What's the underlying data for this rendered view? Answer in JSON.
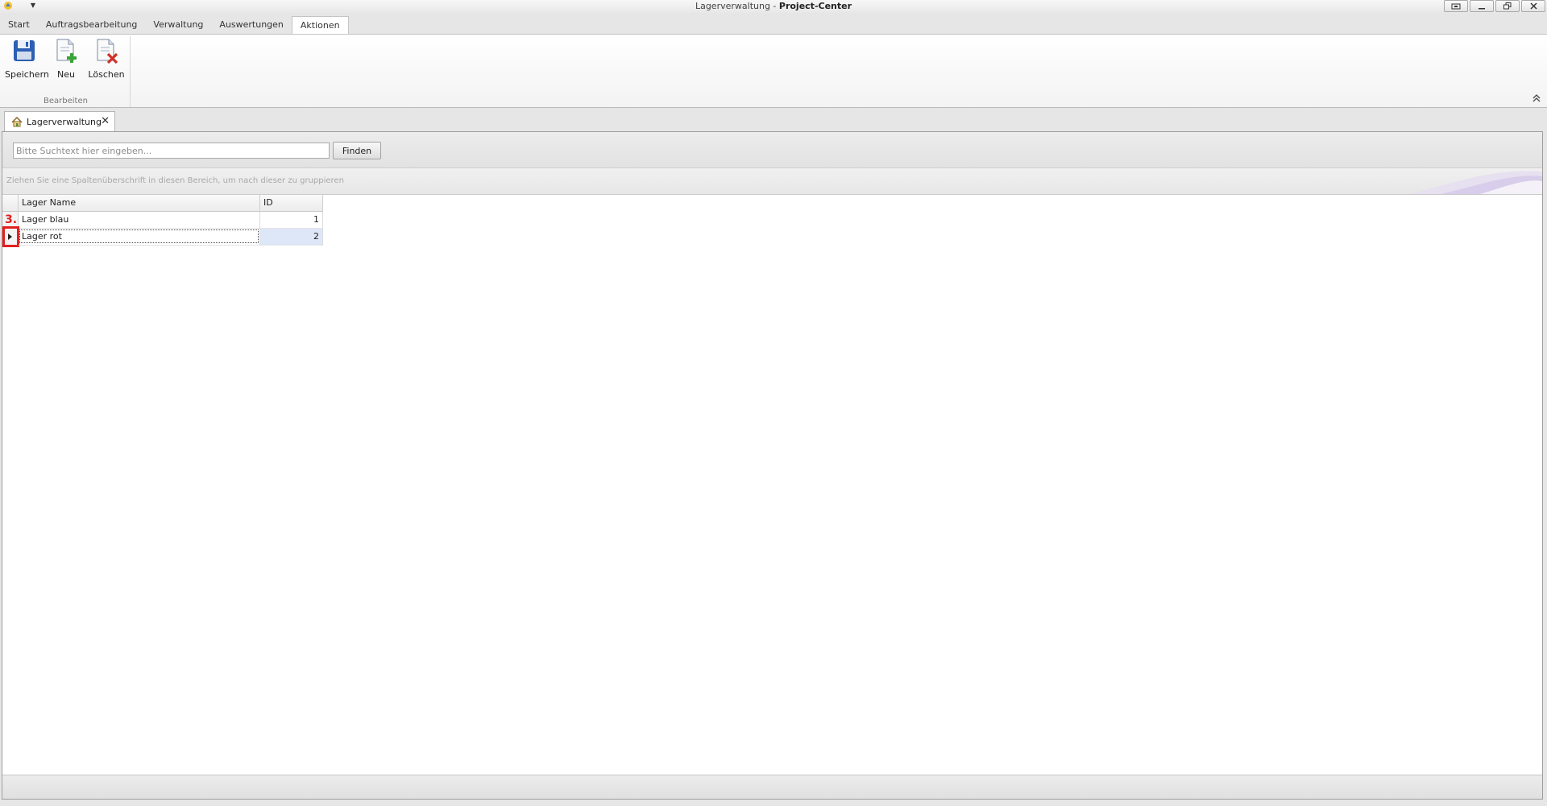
{
  "window": {
    "title_prefix": "Lagerverwaltung - ",
    "title_app": "Project-Center",
    "buttons": [
      "restore-focus",
      "minimize",
      "restore",
      "close"
    ]
  },
  "ribbon": {
    "tabs": [
      "Start",
      "Auftragsbearbeitung",
      "Verwaltung",
      "Auswertungen",
      "Aktionen"
    ],
    "active_tab": "Aktionen",
    "group": {
      "label": "Bearbeiten",
      "buttons": [
        {
          "label": "Speichern",
          "icon": "save-icon"
        },
        {
          "label": "Neu",
          "icon": "new-document-icon"
        },
        {
          "label": "Löschen",
          "icon": "delete-document-icon"
        }
      ]
    }
  },
  "document_tab": {
    "label": "Lagerverwaltung",
    "icon": "home-icon",
    "close": "✕"
  },
  "search": {
    "placeholder": "Bitte Suchtext hier eingeben...",
    "button": "Finden"
  },
  "group_panel": {
    "hint": "Ziehen Sie eine Spaltenüberschrift in diesen Bereich, um nach dieser zu gruppieren"
  },
  "grid": {
    "columns": [
      "Lager Name",
      "ID"
    ],
    "rows": [
      {
        "name": "Lager blau",
        "id": "1"
      },
      {
        "name": "Lager rot",
        "id": "2"
      }
    ],
    "selected_row": 1
  },
  "annotation": {
    "step": "3."
  },
  "colors": {
    "annotation": "#e02020",
    "selection": "#dde7f8"
  }
}
